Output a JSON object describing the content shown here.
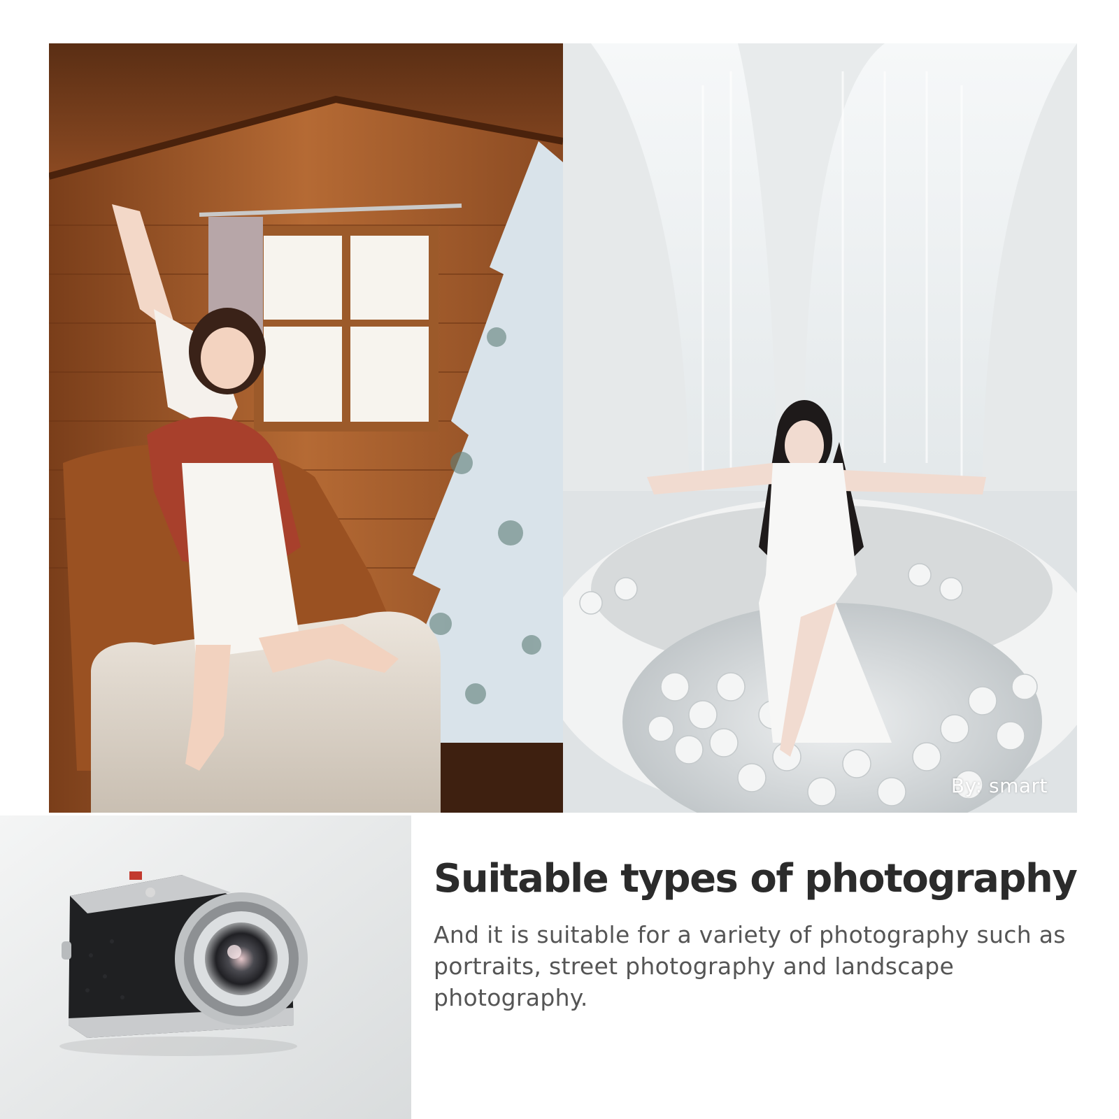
{
  "photos": {
    "left": {
      "subject": "woman in white dress with plaid scarf in wooden cabin beside a frosted christmas tree"
    },
    "right": {
      "subject": "woman in white dress seated in a white ball pit under arched windows",
      "credit": "By:  smart"
    }
  },
  "product": {
    "subject": "silver and black mirrorless camera with lens"
  },
  "headline": "Suitable types of photography",
  "description": "And it is suitable for a variety of photography such as portraits, street photography and landscape photography.",
  "colors": {
    "headline": "#2b2b2b",
    "body": "#555555",
    "wood": "#a05a2c",
    "studio": "#f2f2f2"
  }
}
